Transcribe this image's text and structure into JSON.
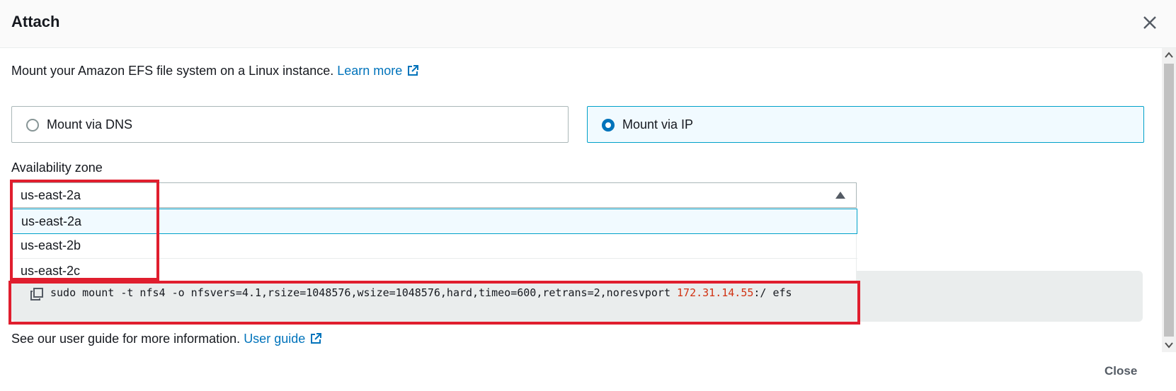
{
  "dialog": {
    "title": "Attach",
    "description": "Mount your Amazon EFS file system on a Linux instance.",
    "learn_more": "Learn more",
    "mount_options": [
      {
        "label": "Mount via DNS",
        "selected": false
      },
      {
        "label": "Mount via IP",
        "selected": true
      }
    ],
    "az_label": "Availability zone",
    "az_selected": "us-east-2a",
    "az_options": [
      "us-east-2a",
      "us-east-2b",
      "us-east-2c"
    ],
    "command_prefix": "sudo mount -t nfs4 -o nfsvers=4.1,rsize=1048576,wsize=1048576,hard,timeo=600,retrans=2,noresvport",
    "command_ip": "172.31.14.55",
    "command_suffix": ":/ efs",
    "guide_text": "See our user guide for more information.",
    "guide_link": "User guide",
    "footer_close": "Close"
  },
  "colors": {
    "link": "#0073bb",
    "selected_border": "#00a1c9",
    "ip_text": "#d13212",
    "highlight": "#e01e2e"
  },
  "icons": [
    "close-icon",
    "external-link-icon",
    "caret-up-icon",
    "copy-icon",
    "scroll-up-icon",
    "scroll-down-icon"
  ]
}
